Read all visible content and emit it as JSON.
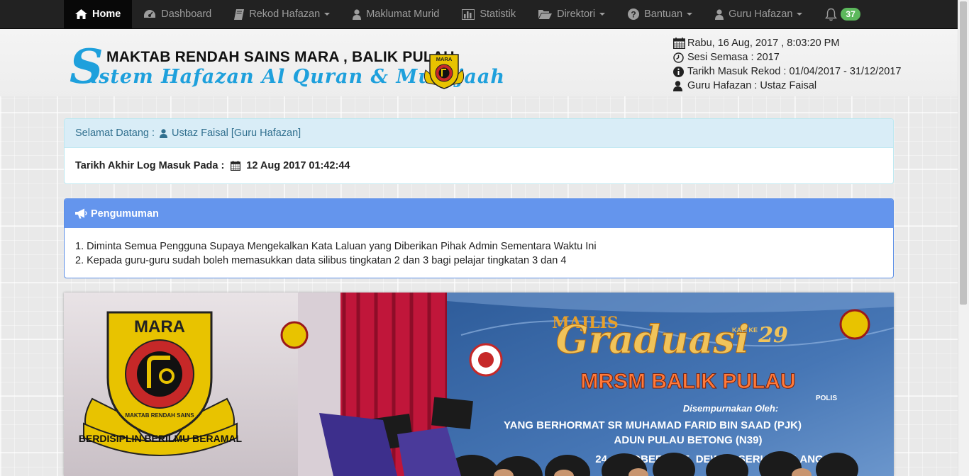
{
  "nav": {
    "items": [
      {
        "label": "Home",
        "icon": "home-icon",
        "active": true
      },
      {
        "label": "Dashboard",
        "icon": "dashboard-icon"
      },
      {
        "label": "Rekod Hafazan",
        "icon": "book-icon",
        "dropdown": true
      },
      {
        "label": "Maklumat Murid",
        "icon": "user-icon"
      },
      {
        "label": "Statistik",
        "icon": "bar-chart-icon"
      },
      {
        "label": "Direktori",
        "icon": "folder-open-icon",
        "dropdown": true
      },
      {
        "label": "Bantuan",
        "icon": "question-icon",
        "dropdown": true
      },
      {
        "label": "Guru Hafazan",
        "icon": "user-icon",
        "dropdown": true
      }
    ],
    "notification_count": "37"
  },
  "header": {
    "school_name": "MAKTAB RENDAH SAINS MARA , BALIK PULAU",
    "system_name_initial": "S",
    "system_name": "istem Hafazan Al Quran & Murajaah",
    "emblem_text": "MARA",
    "info": {
      "datetime": "Rabu, 16 Aug, 2017 , 8:03:20 PM",
      "session": "Sesi Semasa : 2017",
      "record_date": "Tarikh Masuk Rekod : 01/04/2017 - 31/12/2017",
      "teacher": "Guru Hafazan : Ustaz Faisal"
    }
  },
  "welcome": {
    "greeting_label": "Selamat Datang :",
    "user": "Ustaz Faisal [Guru Hafazan]",
    "last_login_label": "Tarikh Akhir Log Masuk Pada :",
    "last_login_value": "12 Aug 2017 01:42:44"
  },
  "announcement": {
    "title": "Pengumuman",
    "items": [
      "1. Diminta Semua Pengguna Supaya Mengekalkan Kata Laluan yang Diberikan Pihak Admin Sementara Waktu Ini",
      "2. Kepada guru-guru sudah boleh memasukkan data silibus tingkatan 2 dan 3 bagi pelajar tingkatan 3 dan 4"
    ]
  },
  "banner": {
    "emblem_top": "MARA",
    "emblem_ring": "MAKTAB RENDAH SAINS",
    "emblem_motto": "BERDISIPLIN BERILMU BERAMAL",
    "majlis": "MAJLIS",
    "graduasi": "Graduasi",
    "kali": "KALI KE",
    "kali_no": "29",
    "school": "MRSM BALIK PULAU",
    "sempurna": "Disempurnakan Oleh:",
    "yb": "YANG BERHORMAT SR MUHAMAD FARID BIN SAAD (PJK)",
    "adun": "ADUN PULAU BETONG (N39)",
    "date_venue": "24 OKTOBER 2015, DEWAN SERI GEMILANG",
    "polis": "POLIS"
  }
}
